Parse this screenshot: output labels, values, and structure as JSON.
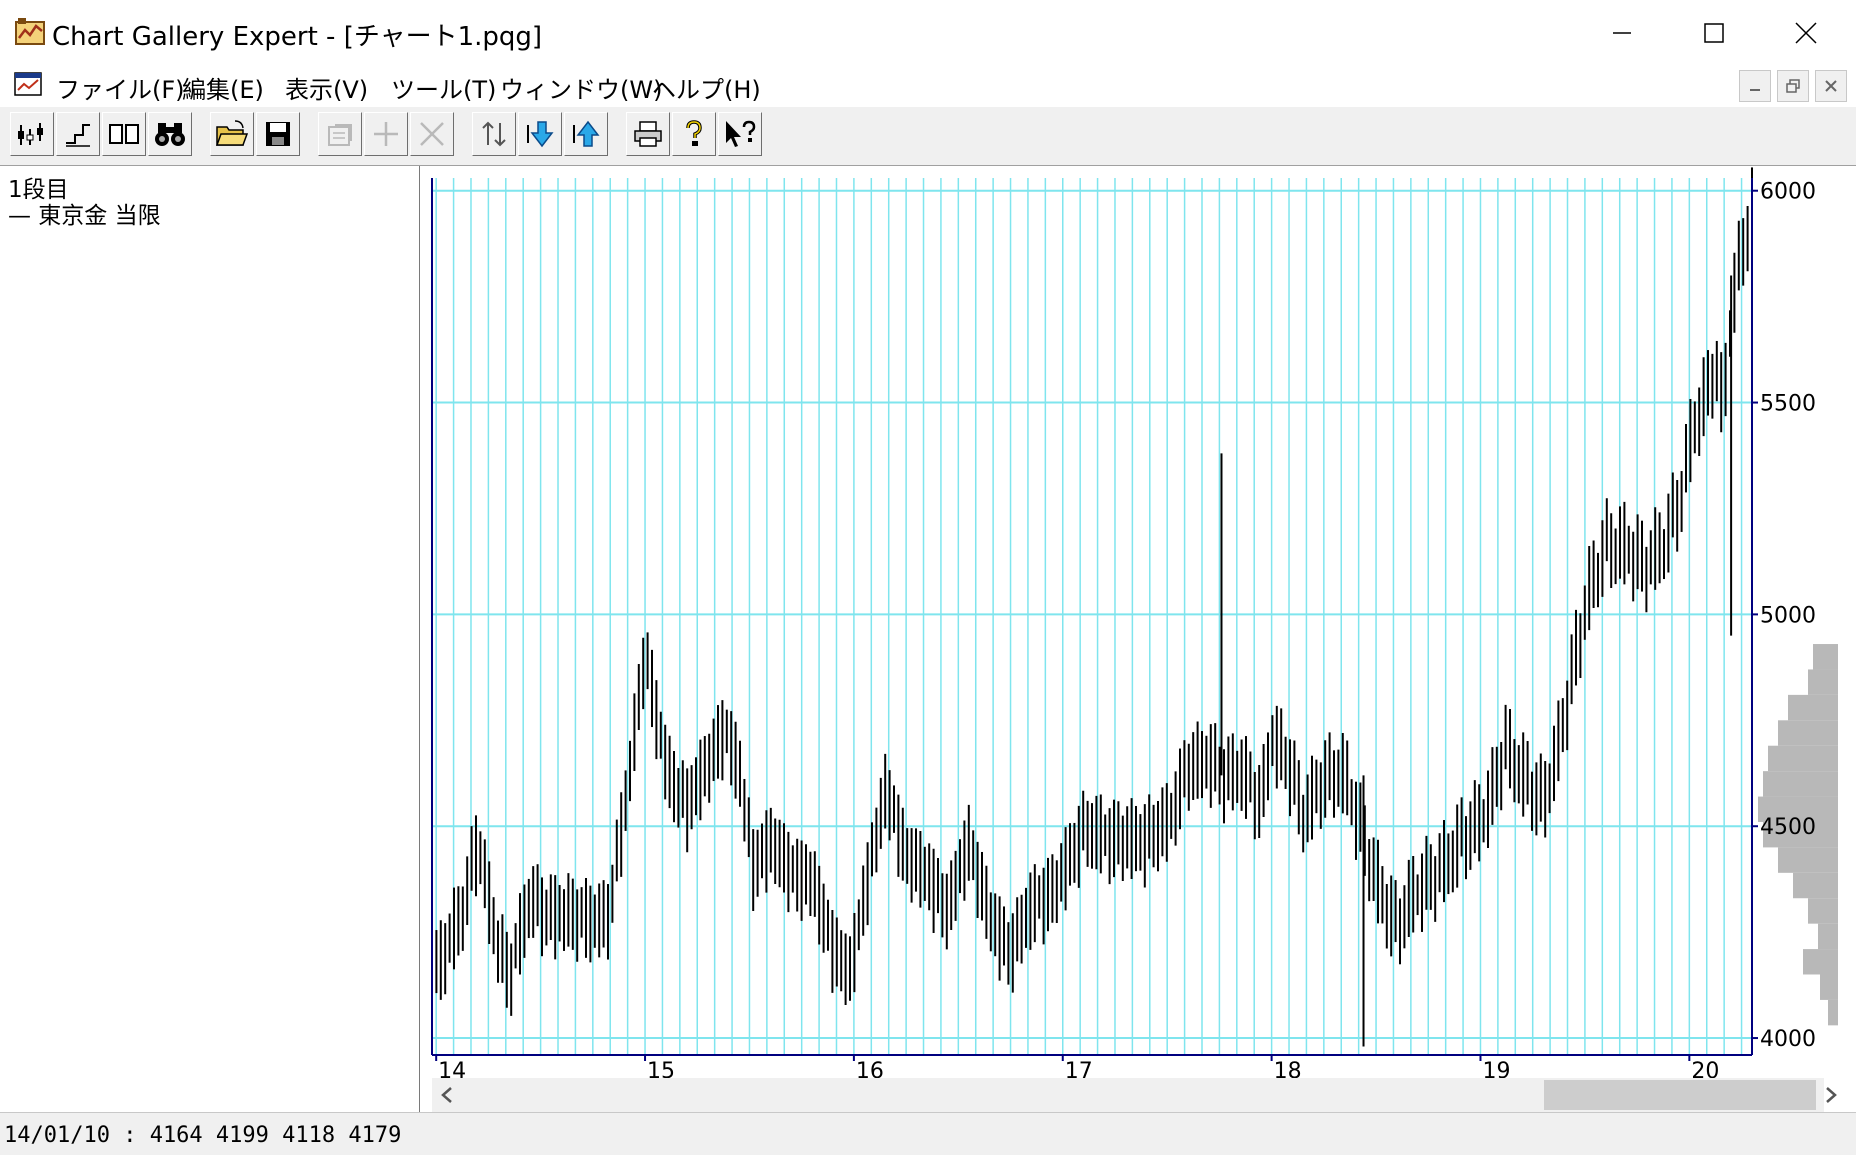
{
  "window": {
    "title": "Chart Gallery Expert - [チャート1.pqg]"
  },
  "menu": {
    "items": [
      "ファイル(F)",
      "編集(E)",
      "表示(V)",
      "ツール(T)",
      "ウィンドウ(W)",
      "ヘルプ(H)"
    ]
  },
  "toolbar": {
    "buttons": [
      {
        "icon": "candlestick-chart-icon",
        "enabled": true
      },
      {
        "icon": "step-line-icon",
        "enabled": true
      },
      {
        "icon": "two-pane-icon",
        "enabled": true
      },
      {
        "icon": "binoculars-icon",
        "enabled": true
      },
      {
        "icon": "open-folder-icon",
        "enabled": true
      },
      {
        "icon": "save-disk-icon",
        "enabled": true
      },
      {
        "icon": "properties-icon",
        "enabled": false
      },
      {
        "icon": "add-icon",
        "enabled": false
      },
      {
        "icon": "delete-icon",
        "enabled": false
      },
      {
        "icon": "move-icon",
        "enabled": true
      },
      {
        "icon": "arrow-down-icon",
        "enabled": true
      },
      {
        "icon": "arrow-up-icon",
        "enabled": true
      },
      {
        "icon": "printer-icon",
        "enabled": true
      },
      {
        "icon": "help-icon",
        "enabled": true
      },
      {
        "icon": "context-help-icon",
        "enabled": true
      }
    ]
  },
  "legend_pane": {
    "panel_label": "1段目",
    "series_label": "— 東京金 当限"
  },
  "status": {
    "text": "14/01/10 : 4164 4199 4118 4179"
  },
  "colors": {
    "grid": "#7fe5ee",
    "axis": "#00007f",
    "bars": "#000000",
    "volume_profile": "#b8b8b8"
  },
  "chart_data": {
    "type": "bar",
    "series_name": "東京金 当限",
    "x_tick_labels": [
      "14",
      "15",
      "16",
      "17",
      "18",
      "19",
      "20"
    ],
    "y_tick_labels": [
      "6000",
      "5500",
      "5000",
      "4500",
      "4000"
    ],
    "ylim": [
      3960,
      6030
    ],
    "grid": true,
    "x_range": [
      13.98,
      20.3
    ],
    "first_bar": {
      "date": "14/01/10",
      "open": 4164,
      "high": 4199,
      "low": 4118,
      "close": 4179
    },
    "price_path": [
      [
        14.0,
        4150
      ],
      [
        14.12,
        4280
      ],
      [
        14.2,
        4480
      ],
      [
        14.28,
        4250
      ],
      [
        14.35,
        4130
      ],
      [
        14.45,
        4330
      ],
      [
        14.55,
        4300
      ],
      [
        14.7,
        4270
      ],
      [
        14.82,
        4290
      ],
      [
        14.92,
        4600
      ],
      [
        15.0,
        4900
      ],
      [
        15.1,
        4650
      ],
      [
        15.2,
        4550
      ],
      [
        15.3,
        4630
      ],
      [
        15.38,
        4730
      ],
      [
        15.45,
        4650
      ],
      [
        15.52,
        4400
      ],
      [
        15.6,
        4450
      ],
      [
        15.7,
        4400
      ],
      [
        15.8,
        4380
      ],
      [
        15.9,
        4200
      ],
      [
        15.98,
        4150
      ],
      [
        16.05,
        4350
      ],
      [
        16.15,
        4580
      ],
      [
        16.25,
        4420
      ],
      [
        16.35,
        4400
      ],
      [
        16.45,
        4300
      ],
      [
        16.55,
        4450
      ],
      [
        16.65,
        4300
      ],
      [
        16.75,
        4200
      ],
      [
        16.85,
        4300
      ],
      [
        16.95,
        4350
      ],
      [
        17.0,
        4400
      ],
      [
        17.1,
        4480
      ],
      [
        17.2,
        4470
      ],
      [
        17.3,
        4480
      ],
      [
        17.4,
        4460
      ],
      [
        17.5,
        4500
      ],
      [
        17.6,
        4650
      ],
      [
        17.7,
        4650
      ],
      [
        17.78,
        4600
      ],
      [
        17.85,
        4640
      ],
      [
        17.95,
        4560
      ],
      [
        18.0,
        4700
      ],
      [
        18.08,
        4640
      ],
      [
        18.15,
        4530
      ],
      [
        18.25,
        4620
      ],
      [
        18.35,
        4610
      ],
      [
        18.42,
        4500
      ],
      [
        18.5,
        4380
      ],
      [
        18.6,
        4260
      ],
      [
        18.7,
        4340
      ],
      [
        18.8,
        4400
      ],
      [
        18.9,
        4460
      ],
      [
        19.0,
        4500
      ],
      [
        19.05,
        4560
      ],
      [
        19.12,
        4700
      ],
      [
        19.2,
        4620
      ],
      [
        19.3,
        4540
      ],
      [
        19.38,
        4700
      ],
      [
        19.45,
        4900
      ],
      [
        19.52,
        5050
      ],
      [
        19.6,
        5150
      ],
      [
        19.7,
        5160
      ],
      [
        19.8,
        5120
      ],
      [
        19.88,
        5160
      ],
      [
        19.95,
        5250
      ],
      [
        20.02,
        5450
      ],
      [
        20.08,
        5520
      ],
      [
        20.12,
        5600
      ],
      [
        20.16,
        5480
      ],
      [
        20.2,
        5700
      ],
      [
        20.25,
        5850
      ],
      [
        20.3,
        5950
      ]
    ],
    "spikes": [
      {
        "x": 17.76,
        "high": 5380,
        "low": 4620
      },
      {
        "x": 18.44,
        "high": 4620,
        "low": 3980
      },
      {
        "x": 20.2,
        "high": 5800,
        "low": 4950
      }
    ]
  }
}
